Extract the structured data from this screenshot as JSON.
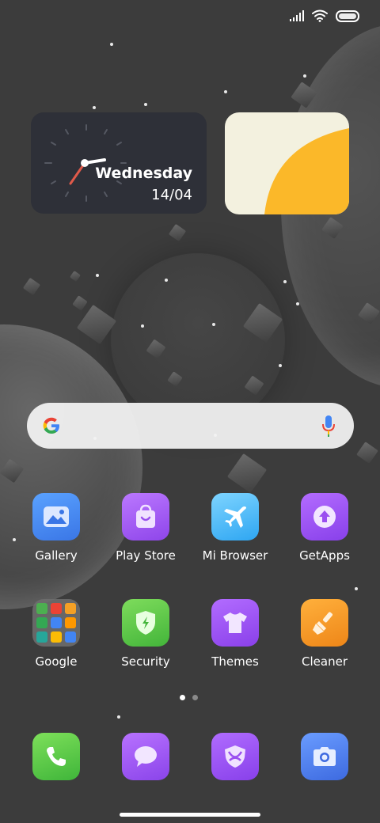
{
  "status_bar": {
    "signal_icon": "signal-bars-icon",
    "wifi_icon": "wifi-icon",
    "battery_icon": "battery-icon"
  },
  "clock_widget": {
    "day": "Wednesday",
    "date": "14/04"
  },
  "search": {
    "google_icon": "google-g-icon",
    "mic_icon": "microphone-icon"
  },
  "apps": [
    {
      "label": "Gallery",
      "icon": "gallery-icon",
      "color": "#4a8df0"
    },
    {
      "label": "Play Store",
      "icon": "shopping-bag-icon",
      "color": "#a35cf0"
    },
    {
      "label": "Mi Browser",
      "icon": "airplane-icon",
      "color": "#3cb6f5"
    },
    {
      "label": "GetApps",
      "icon": "upload-arrow-icon",
      "color": "#9b4ff0"
    },
    {
      "label": "Google",
      "icon": "folder-icon",
      "color": "#5a5a5a"
    },
    {
      "label": "Security",
      "icon": "shield-bolt-icon",
      "color": "#5bc846"
    },
    {
      "label": "Themes",
      "icon": "tshirt-icon",
      "color": "#9a4cf0"
    },
    {
      "label": "Cleaner",
      "icon": "brush-icon",
      "color": "#f39a28"
    }
  ],
  "page_indicator": {
    "pages": 2,
    "current": 1
  },
  "dock": [
    {
      "icon": "phone-icon",
      "color": "#5cc83a"
    },
    {
      "icon": "message-icon",
      "color": "#a153ee"
    },
    {
      "icon": "shield-browser-icon",
      "color": "#9a4ff0"
    },
    {
      "icon": "camera-icon",
      "color": "#4a78ec"
    }
  ]
}
